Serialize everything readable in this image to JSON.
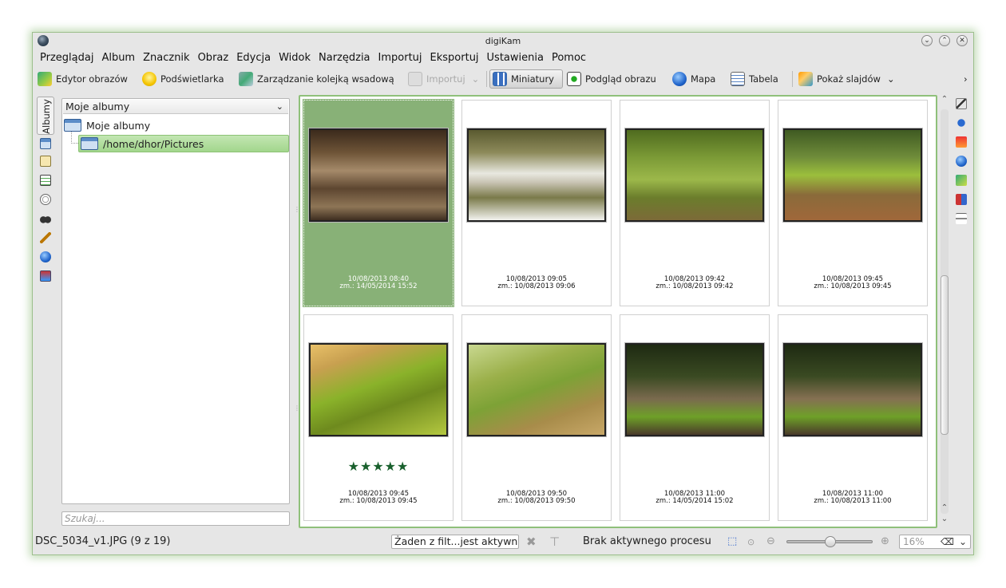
{
  "window": {
    "title": "digiKam",
    "border_color": "#9cbf8c",
    "accent": "#88b177"
  },
  "window_buttons": [
    "⌄",
    "⌃",
    "✕"
  ],
  "menu": [
    "Przeglądaj",
    "Album",
    "Znacznik",
    "Obraz",
    "Edycja",
    "Widok",
    "Narzędzia",
    "Importuj",
    "Eksportuj",
    "Ustawienia",
    "Pomoc"
  ],
  "toolbar": {
    "image_editor": "Edytor obrazów",
    "light_table": "Podświetlarka",
    "batch_queue": "Zarządzanie kolejką wsadową",
    "import": "Importuj",
    "thumbnails": "Miniatury",
    "preview": "Podgląd obrazu",
    "map": "Mapa",
    "table": "Tabela",
    "slideshow": "Pokaż slajdów",
    "more": "›"
  },
  "left_tab": {
    "label": "Albumy"
  },
  "album_panel": {
    "combo_label": "Moje albumy",
    "root_label": "Moje albumy",
    "selected_album": "/home/dhor/Pictures",
    "search_placeholder": "Szukaj..."
  },
  "thumbnails": [
    {
      "date": "10/08/2013 08:40",
      "modified": "zm.: 14/05/2014 15:52",
      "selected": true,
      "rating": 0
    },
    {
      "date": "10/08/2013 09:05",
      "modified": "zm.: 10/08/2013 09:06",
      "selected": false,
      "rating": 0
    },
    {
      "date": "10/08/2013 09:42",
      "modified": "zm.: 10/08/2013 09:42",
      "selected": false,
      "rating": 0
    },
    {
      "date": "10/08/2013 09:45",
      "modified": "zm.: 10/08/2013 09:45",
      "selected": false,
      "rating": 0
    },
    {
      "date": "10/08/2013 09:45",
      "modified": "zm.: 10/08/2013 09:45",
      "selected": false,
      "rating": 5,
      "stars": "★★★★★"
    },
    {
      "date": "10/08/2013 09:50",
      "modified": "zm.: 10/08/2013 09:50",
      "selected": false,
      "rating": 0
    },
    {
      "date": "10/08/2013 11:00",
      "modified": "zm.: 14/05/2014 15:02",
      "selected": false,
      "rating": 0
    },
    {
      "date": "10/08/2013 11:00",
      "modified": "zm.: 10/08/2013 11:00",
      "selected": false,
      "rating": 0
    }
  ],
  "statusbar": {
    "file_info": "DSC_5034_v1.JPG (9 z 19)",
    "filter_text": "Żaden z filt...jest aktywny",
    "process_text": "Brak aktywnego procesu",
    "zoom_value": "16%",
    "zoom_fraction": 0.5
  }
}
